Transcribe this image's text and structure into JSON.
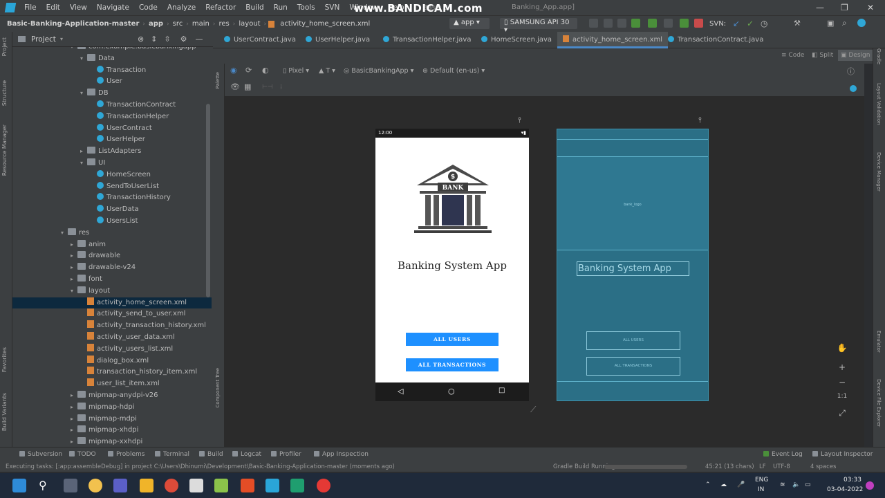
{
  "menubar": {
    "items": [
      "File",
      "Edit",
      "View",
      "Navigate",
      "Code",
      "Analyze",
      "Refactor",
      "Build",
      "Run",
      "Tools",
      "SVN",
      "Window",
      "Help"
    ],
    "window_title_left": "Basic B",
    "window_title_right": "Banking_App.app]"
  },
  "watermark": "www.BANDICAM.com",
  "navbar": {
    "crumbs": [
      "Basic-Banking-Application-master",
      "app",
      "src",
      "main",
      "res",
      "layout",
      "activity_home_screen.xml"
    ],
    "run_config": "app",
    "device": "SAMSUNG API 30",
    "svn_label": "SVN:"
  },
  "project_panel": {
    "title": "Project",
    "tree": [
      {
        "label": "com.example.basicbankingapp",
        "type": "folder",
        "arrow": "down",
        "indent": 0
      },
      {
        "label": "Data",
        "type": "folder",
        "arrow": "down",
        "indent": 1
      },
      {
        "label": "Transaction",
        "type": "class",
        "arrow": "",
        "indent": 2
      },
      {
        "label": "User",
        "type": "class",
        "arrow": "",
        "indent": 2
      },
      {
        "label": "DB",
        "type": "folder",
        "arrow": "down",
        "indent": 1
      },
      {
        "label": "TransactionContract",
        "type": "class",
        "arrow": "",
        "indent": 2
      },
      {
        "label": "TransactionHelper",
        "type": "class",
        "arrow": "",
        "indent": 2
      },
      {
        "label": "UserContract",
        "type": "class",
        "arrow": "",
        "indent": 2
      },
      {
        "label": "UserHelper",
        "type": "class",
        "arrow": "",
        "indent": 2
      },
      {
        "label": "ListAdapters",
        "type": "folder",
        "arrow": "right",
        "indent": 1
      },
      {
        "label": "UI",
        "type": "folder",
        "arrow": "down",
        "indent": 1
      },
      {
        "label": "HomeScreen",
        "type": "class",
        "arrow": "",
        "indent": 2
      },
      {
        "label": "SendToUserList",
        "type": "class",
        "arrow": "",
        "indent": 2
      },
      {
        "label": "TransactionHistory",
        "type": "class",
        "arrow": "",
        "indent": 2
      },
      {
        "label": "UserData",
        "type": "class",
        "arrow": "",
        "indent": 2
      },
      {
        "label": "UsersList",
        "type": "class",
        "arrow": "",
        "indent": 2
      },
      {
        "label": "res",
        "type": "folder",
        "arrow": "down",
        "indent": -1
      },
      {
        "label": "anim",
        "type": "folder",
        "arrow": "right",
        "indent": 0
      },
      {
        "label": "drawable",
        "type": "folder",
        "arrow": "right",
        "indent": 0
      },
      {
        "label": "drawable-v24",
        "type": "folder",
        "arrow": "right",
        "indent": 0
      },
      {
        "label": "font",
        "type": "folder",
        "arrow": "right",
        "indent": 0
      },
      {
        "label": "layout",
        "type": "folder",
        "arrow": "down",
        "indent": 0
      },
      {
        "label": "activity_home_screen.xml",
        "type": "xml",
        "arrow": "",
        "indent": 1,
        "selected": true
      },
      {
        "label": "activity_send_to_user.xml",
        "type": "xml",
        "arrow": "",
        "indent": 1
      },
      {
        "label": "activity_transaction_history.xml",
        "type": "xml",
        "arrow": "",
        "indent": 1
      },
      {
        "label": "activity_user_data.xml",
        "type": "xml",
        "arrow": "",
        "indent": 1
      },
      {
        "label": "activity_users_list.xml",
        "type": "xml",
        "arrow": "",
        "indent": 1
      },
      {
        "label": "dialog_box.xml",
        "type": "xml",
        "arrow": "",
        "indent": 1
      },
      {
        "label": "transaction_history_item.xml",
        "type": "xml",
        "arrow": "",
        "indent": 1
      },
      {
        "label": "user_list_item.xml",
        "type": "xml",
        "arrow": "",
        "indent": 1
      },
      {
        "label": "mipmap-anydpi-v26",
        "type": "folder",
        "arrow": "right",
        "indent": 0
      },
      {
        "label": "mipmap-hdpi",
        "type": "folder",
        "arrow": "right",
        "indent": 0
      },
      {
        "label": "mipmap-mdpi",
        "type": "folder",
        "arrow": "right",
        "indent": 0
      },
      {
        "label": "mipmap-xhdpi",
        "type": "folder",
        "arrow": "right",
        "indent": 0
      },
      {
        "label": "mipmap-xxhdpi",
        "type": "folder",
        "arrow": "right",
        "indent": 0
      }
    ]
  },
  "editor_tabs": [
    {
      "label": "UserContract.java",
      "kind": "java"
    },
    {
      "label": "UserHelper.java",
      "kind": "java"
    },
    {
      "label": "TransactionHelper.java",
      "kind": "java"
    },
    {
      "label": "HomeScreen.java",
      "kind": "java"
    },
    {
      "label": "activity_home_screen.xml",
      "kind": "xml",
      "active": true
    },
    {
      "label": "TransactionContract.java",
      "kind": "java"
    }
  ],
  "view_modes": [
    "Code",
    "Split",
    "Design"
  ],
  "design_toolbar": {
    "device": "Pixel",
    "api": "T",
    "theme": "BasicBankingApp",
    "locale": "Default (en-us)"
  },
  "side_tabs_left": [
    "Project",
    "Structure",
    "Resource Manager",
    "Favorites",
    "Build Variants"
  ],
  "side_tabs_right": [
    "Gradle",
    "Layout Validation",
    "Device Manager",
    "Emulator",
    "Device File Explorer"
  ],
  "palette_tabs": [
    "Palette",
    "Component Tree"
  ],
  "preview": {
    "status_time": "12:00",
    "bank_sign": "BANK",
    "app_title": "Banking System App",
    "btn_users": "ALL USERS",
    "btn_transactions": "ALL TRANSACTIONS"
  },
  "blueprint": {
    "image_label": "bank_logo",
    "title": "Banking System App",
    "btn_users": "ALL USERS",
    "btn_transactions": "ALL TRANSACTIONS"
  },
  "bottom_tabs": [
    "Subversion",
    "TODO",
    "Problems",
    "Terminal",
    "Build",
    "Logcat",
    "Profiler",
    "App Inspection",
    "Event Log",
    "Layout Inspector"
  ],
  "status": {
    "message": "Executing tasks: [:app:assembleDebug] in project C:\\Users\\Dhinumi\\Development\\Basic-Banking-Application-master (moments ago)",
    "gradle": "Gradle Build Running",
    "position": "45:21 (13 chars)",
    "line_sep": "LF",
    "encoding": "UTF-8",
    "indent": "4 spaces"
  },
  "taskbar": {
    "lang_top": "ENG",
    "lang_bottom": "IN",
    "time": "03:33",
    "date": "03-04-2022"
  },
  "colors": {
    "ide_bg": "#2b2d30",
    "panel_bg": "#3c3f41",
    "selection": "#0d293e",
    "accent_blue": "#1e90ff",
    "blueprint_bg": "#2b6f86"
  }
}
